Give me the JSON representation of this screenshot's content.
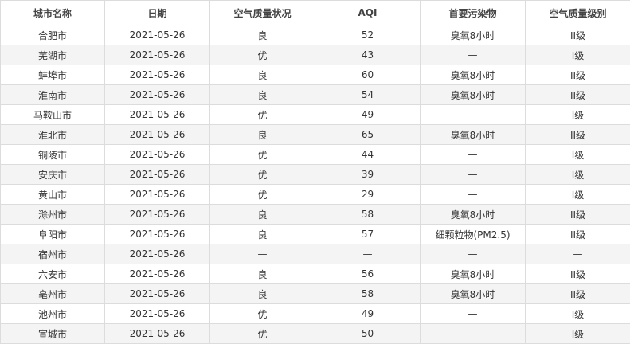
{
  "table": {
    "headers": [
      "城市名称",
      "日期",
      "空气质量状况",
      "AQI",
      "首要污染物",
      "空气质量级别"
    ],
    "rows": [
      [
        "合肥市",
        "2021-05-26",
        "良",
        "52",
        "臭氧8小时",
        "II级"
      ],
      [
        "芜湖市",
        "2021-05-26",
        "优",
        "43",
        "—",
        "I级"
      ],
      [
        "蚌埠市",
        "2021-05-26",
        "良",
        "60",
        "臭氧8小时",
        "II级"
      ],
      [
        "淮南市",
        "2021-05-26",
        "良",
        "54",
        "臭氧8小时",
        "II级"
      ],
      [
        "马鞍山市",
        "2021-05-26",
        "优",
        "49",
        "—",
        "I级"
      ],
      [
        "淮北市",
        "2021-05-26",
        "良",
        "65",
        "臭氧8小时",
        "II级"
      ],
      [
        "铜陵市",
        "2021-05-26",
        "优",
        "44",
        "—",
        "I级"
      ],
      [
        "安庆市",
        "2021-05-26",
        "优",
        "39",
        "—",
        "I级"
      ],
      [
        "黄山市",
        "2021-05-26",
        "优",
        "29",
        "—",
        "I级"
      ],
      [
        "滁州市",
        "2021-05-26",
        "良",
        "58",
        "臭氧8小时",
        "II级"
      ],
      [
        "阜阳市",
        "2021-05-26",
        "良",
        "57",
        "细颗粒物(PM2.5)",
        "II级"
      ],
      [
        "宿州市",
        "2021-05-26",
        "—",
        "—",
        "—",
        "—"
      ],
      [
        "六安市",
        "2021-05-26",
        "良",
        "56",
        "臭氧8小时",
        "II级"
      ],
      [
        "亳州市",
        "2021-05-26",
        "良",
        "58",
        "臭氧8小时",
        "II级"
      ],
      [
        "池州市",
        "2021-05-26",
        "优",
        "49",
        "—",
        "I级"
      ],
      [
        "宣城市",
        "2021-05-26",
        "优",
        "50",
        "—",
        "I级"
      ]
    ]
  }
}
